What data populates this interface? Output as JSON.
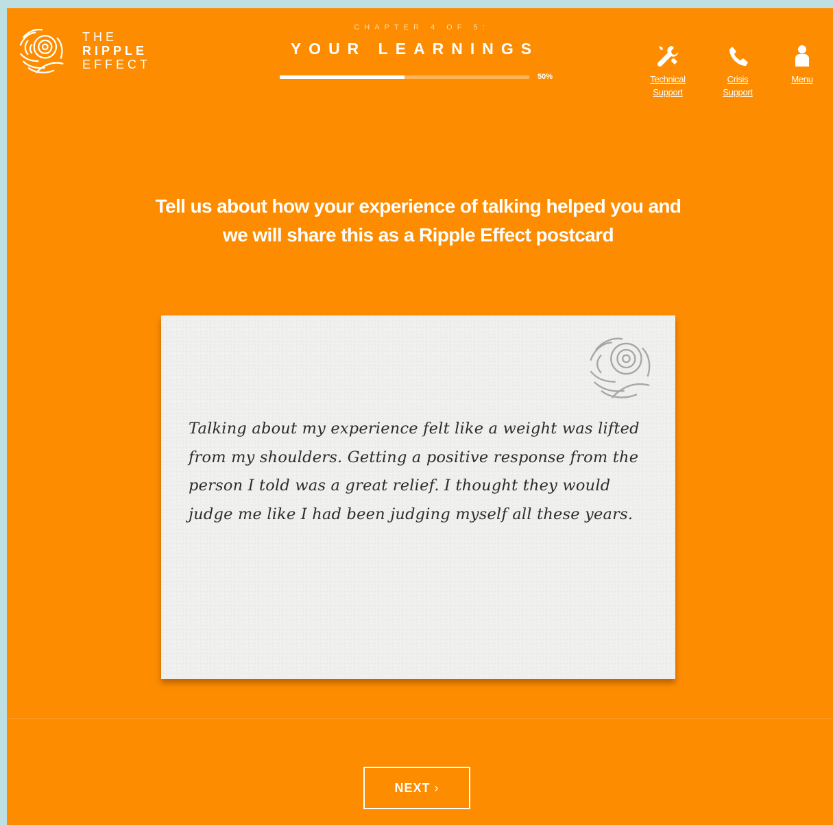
{
  "header": {
    "logo": {
      "line1": "THE",
      "line2": "RIPPLE",
      "line3": "EFFECT",
      "icon": "ripple-logo-icon"
    },
    "chapter_label": "CHAPTER 4 OF 5:",
    "section_title": "YOUR LEARNINGS",
    "progress": {
      "value": 50,
      "label": "50%"
    },
    "nav": [
      {
        "label": "Technical Support",
        "icon": "tools-icon"
      },
      {
        "label": "Crisis Support",
        "icon": "phone-icon"
      },
      {
        "label": "Menu",
        "icon": "user-icon"
      }
    ]
  },
  "main": {
    "prompt": "Tell us about how your experience of talking helped you and we will share this as a Ripple Effect postcard",
    "postcard": {
      "message": "Talking about my experience felt like a weight was lifted from my shoulders. Getting a positive response from the person I told was a great relief. I thought they would judge me like I had been judging myself all these years.",
      "stamp_icon": "ripple-stamp-icon"
    },
    "next_button": {
      "label": "NEXT",
      "icon": "chevron-right-icon"
    }
  },
  "colors": {
    "background": "#fd8c00",
    "outer_border": "#bfe0e3",
    "postcard": "#efefee",
    "text_light": "#ffffff"
  }
}
